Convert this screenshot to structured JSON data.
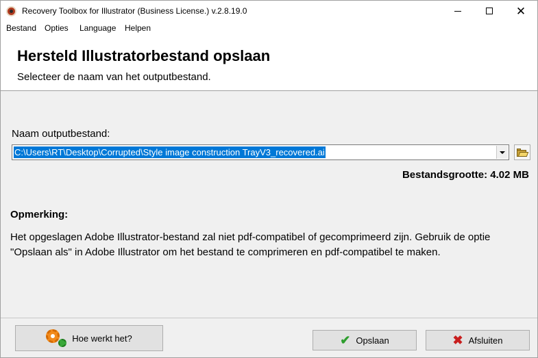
{
  "window": {
    "title": "Recovery Toolbox for Illustrator (Business License.) v.2.8.19.0",
    "controls": {
      "minimize": "minimize-icon",
      "maximize": "maximize-icon",
      "close": "close-icon"
    }
  },
  "menu": {
    "items": [
      {
        "label": "Bestand"
      },
      {
        "label": "Opties"
      },
      {
        "label": "Language"
      },
      {
        "label": "Helpen"
      }
    ]
  },
  "header": {
    "title": "Hersteld Illustratorbestand opslaan",
    "subtitle": "Selecteer de naam van het outputbestand."
  },
  "output": {
    "label": "Naam outputbestand:",
    "path": "C:\\Users\\RT\\Desktop\\Corrupted\\Style image construction TrayV3_recovered.ai",
    "browse_icon": "folder-open-icon",
    "filesize": "Bestandsgrootte: 4.02 MB"
  },
  "note": {
    "title": "Opmerking:",
    "text": "Het opgeslagen Adobe Illustrator-bestand zal niet pdf-compatibel of gecomprimeerd zijn. Gebruik de optie \"Opslaan als\" in Adobe Illustrator om het bestand te comprimeren en pdf-compatibel te maken."
  },
  "buttons": {
    "help": {
      "label": "Hoe werkt het?",
      "icon": "gears-icon"
    },
    "save": {
      "label": "Opslaan",
      "icon": "check-icon"
    },
    "close": {
      "label": "Afsluiten",
      "icon": "x-icon"
    }
  },
  "colors": {
    "selection": "#0078d7",
    "check": "#2e9e2e",
    "cross": "#c81e1e",
    "gear_orange": "#f28a1c",
    "gear_green": "#3aa83a"
  }
}
